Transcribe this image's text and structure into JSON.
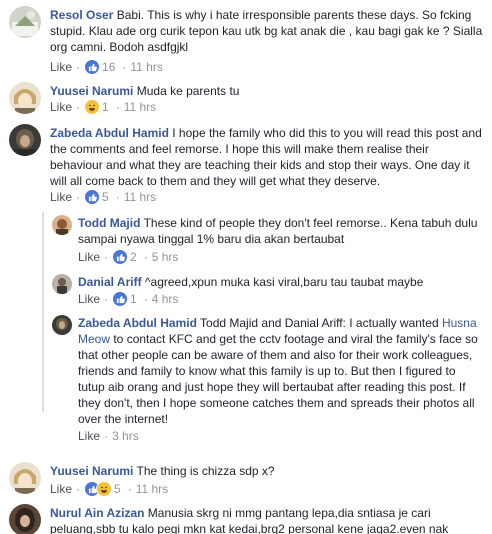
{
  "comments": [
    {
      "author": "Resol Oser",
      "text": "Babi. This is why i hate irresponsible parents these days. So fcking stupid. Klau ade org curik tepon kau utk bg kat anak die , kau bagi gak ke ? Sialla org camni. Bodoh asdfgjkl",
      "like_label": "Like",
      "reaction_count": "16",
      "time": "11 hrs"
    },
    {
      "author": "Yuusei Narumi",
      "text": "Muda ke parents tu",
      "like_label": "Like",
      "reaction_count": "1",
      "time": "11 hrs"
    },
    {
      "author": "Zabeda Abdul Hamid",
      "text": "I hope the family who did this to you will read this post and the comments and feel remorse. I hope this will make them realise their behaviour and what they are teaching their kids and stop their ways. One day it will all come back to them and they will get what they deserve.",
      "like_label": "Like",
      "reaction_count": "5",
      "time": "11 hrs"
    }
  ],
  "replies": [
    {
      "author": "Todd Majid",
      "text": "These kind of people they don't feel remorse.. Kena tabuh dulu sampai nyawa tinggal 1% baru dia akan bertaubat",
      "like_label": "Like",
      "reaction_count": "2",
      "time": "5 hrs"
    },
    {
      "author": "Danial Ariff",
      "text": "^agreed,xpun muka kasi viral,baru tau taubat maybe",
      "like_label": "Like",
      "reaction_count": "1",
      "time": "4 hrs"
    },
    {
      "author": "Zabeda Abdul Hamid",
      "text_before": "Todd Majid and Danial Ariff: I actually wanted ",
      "mention": "Husna Meow",
      "text_after": " to contact KFC and get the cctv footage and viral the family's face so that other people can be aware of them and also for their work colleagues, friends and family to know what this family is up to. But then I figured to tutup aib orang and just hope they will bertaubat after reading this post. If they don't, then I hope someone catches them and spreads their photos all over the internet!",
      "like_label": "Like",
      "time": "3 hrs"
    }
  ],
  "later_comments": [
    {
      "author": "Yuusei Narumi",
      "text": "The thing is chizza sdp x?",
      "like_label": "Like",
      "reaction_count": "5",
      "time": "11 hrs"
    },
    {
      "author": "Nurul Ain Azizan",
      "text": "Manusia skrg ni mmg pantang lepa,dia sntiasa je cari peluang,sbb tu kalo pegi mkn kat kedai,brg2 personal kene jaga2.even nak"
    }
  ],
  "separator": "·",
  "colors": {
    "name": "#385898",
    "meta": "#90949c",
    "like_blue": "#4a76d6",
    "haha_yellow": "#f5c33b"
  }
}
